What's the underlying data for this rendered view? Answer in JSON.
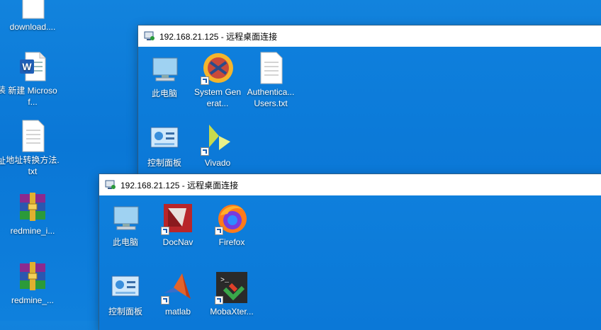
{
  "desktop": {
    "icons": [
      {
        "label": "download...."
      },
      {
        "label": "新建 Microsof..."
      },
      {
        "label": "地址转换方法.txt"
      },
      {
        "label": "redmine_i..."
      },
      {
        "label": "redmine_..."
      }
    ],
    "edge_fragments": [
      "装",
      "址"
    ]
  },
  "windows": [
    {
      "title": "192.168.21.125 - 远程桌面连接",
      "icons": [
        {
          "label": "此电脑"
        },
        {
          "label": "System Generat..."
        },
        {
          "label": "Authentica... Users.txt"
        },
        {
          "label": "控制面板"
        },
        {
          "label": "Vivado"
        }
      ]
    },
    {
      "title": "192.168.21.125 - 远程桌面连接",
      "icons": [
        {
          "label": "此电脑"
        },
        {
          "label": "DocNav"
        },
        {
          "label": "Firefox"
        },
        {
          "label": "控制面板"
        },
        {
          "label": "matlab"
        },
        {
          "label": "MobaXter..."
        }
      ]
    }
  ]
}
